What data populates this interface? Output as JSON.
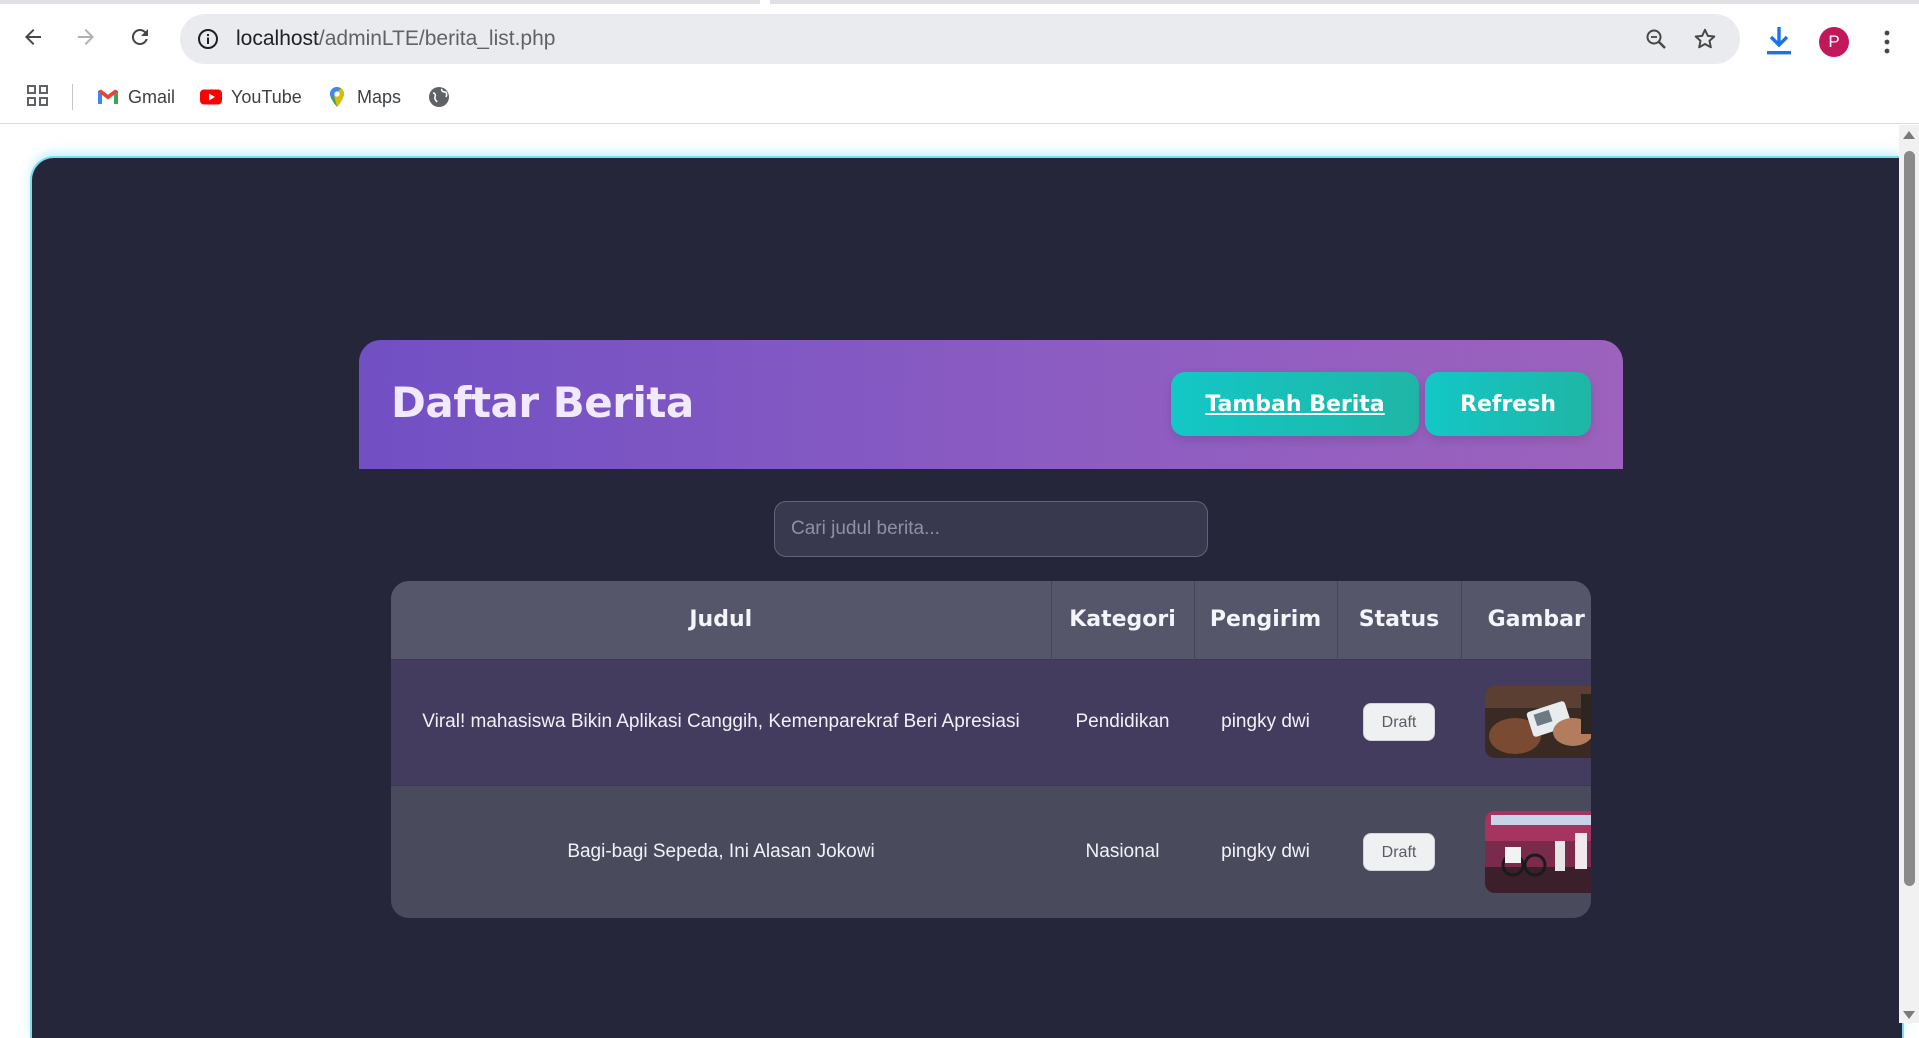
{
  "browser": {
    "url_host": "localhost",
    "url_path": "/adminLTE/berita_list.php",
    "avatar_letter": "P",
    "bookmarks": [
      {
        "label": "Gmail"
      },
      {
        "label": "YouTube"
      },
      {
        "label": "Maps"
      }
    ]
  },
  "page": {
    "title": "Daftar Berita",
    "add_button": "Tambah Berita",
    "refresh_button": "Refresh",
    "search_placeholder": "Cari judul berita...",
    "table": {
      "headers": [
        "Judul",
        "Kategori",
        "Pengirim",
        "Status",
        "Gambar"
      ],
      "rows": [
        {
          "judul": "Viral! mahasiswa Bikin Aplikasi Canggih, Kemenparekraf Beri Apresiasi",
          "kategori": "Pendidikan",
          "pengirim": "pingky dwi",
          "status": "Draft"
        },
        {
          "judul": "Bagi-bagi Sepeda, Ini Alasan Jokowi",
          "kategori": "Nasional",
          "pengirim": "pingky dwi",
          "status": "Draft"
        }
      ]
    }
  },
  "colors": {
    "page_bg": "#25263a",
    "header_gradient_start": "#7150c4",
    "header_gradient_end": "#9c62bd",
    "button_teal": "#13c7c6",
    "avatar_bg": "#c2185b"
  }
}
